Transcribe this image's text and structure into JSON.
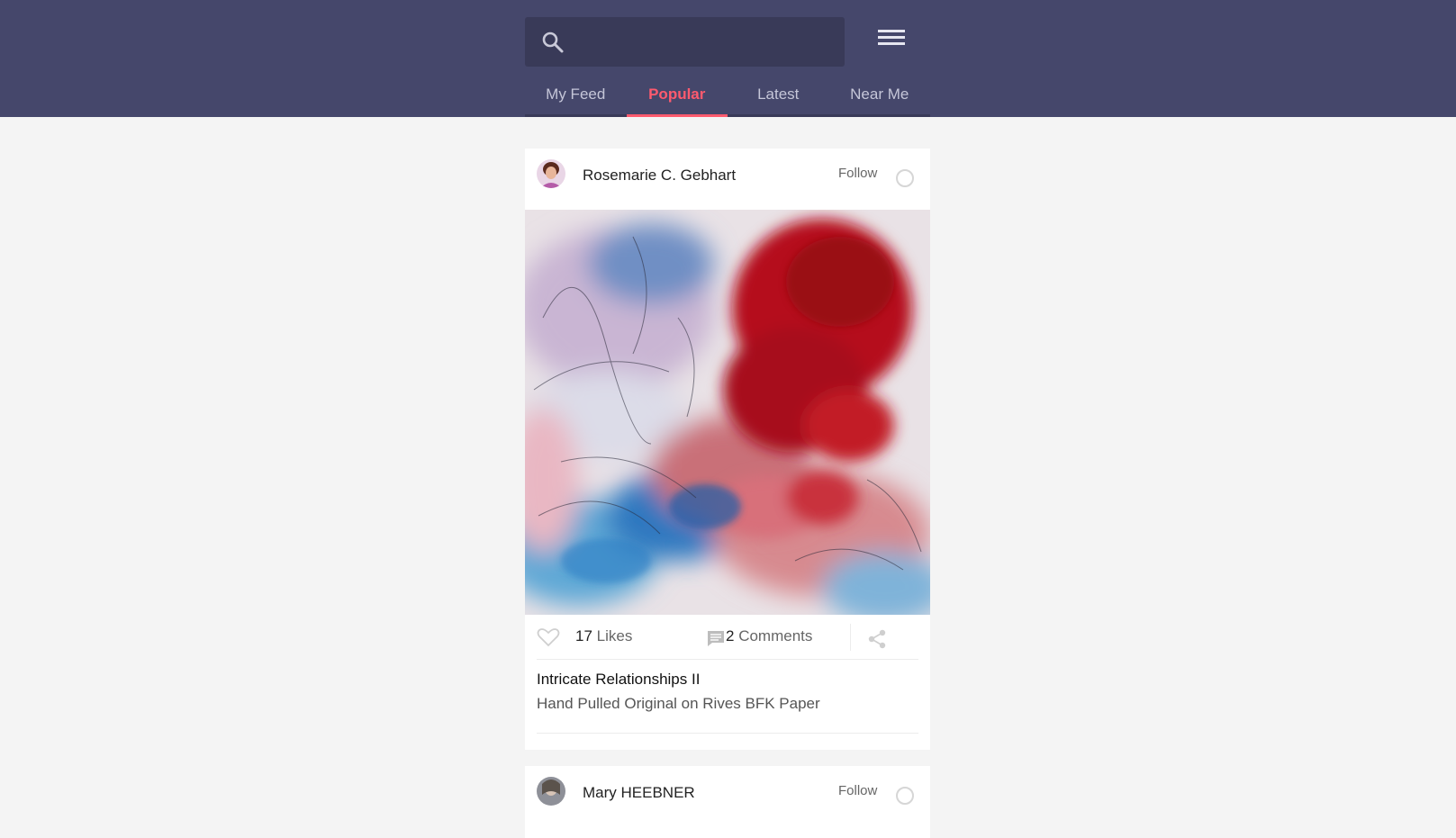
{
  "search": {
    "placeholder": "",
    "icon": "search-icon"
  },
  "menu": {
    "icon": "hamburger-menu-icon"
  },
  "tabs": [
    {
      "label": "My Feed",
      "active": false
    },
    {
      "label": "Popular",
      "active": true
    },
    {
      "label": "Latest",
      "active": false
    },
    {
      "label": "Near Me",
      "active": false
    }
  ],
  "colors": {
    "header_bg": "#45476b",
    "search_bg": "#393a58",
    "accent": "#ff5a6e",
    "page_bg": "#f4f4f4"
  },
  "posts": [
    {
      "author": "Rosemarie C. Gebhart",
      "follow_label": "Follow",
      "likes_count": "17",
      "likes_label": "Likes",
      "comments_count": "2",
      "comments_label": "Comments",
      "title": "Intricate Relationships II",
      "subtitle": "Hand Pulled Original on Rives BFK Paper"
    },
    {
      "author": "Mary HEEBNER",
      "follow_label": "Follow"
    }
  ]
}
